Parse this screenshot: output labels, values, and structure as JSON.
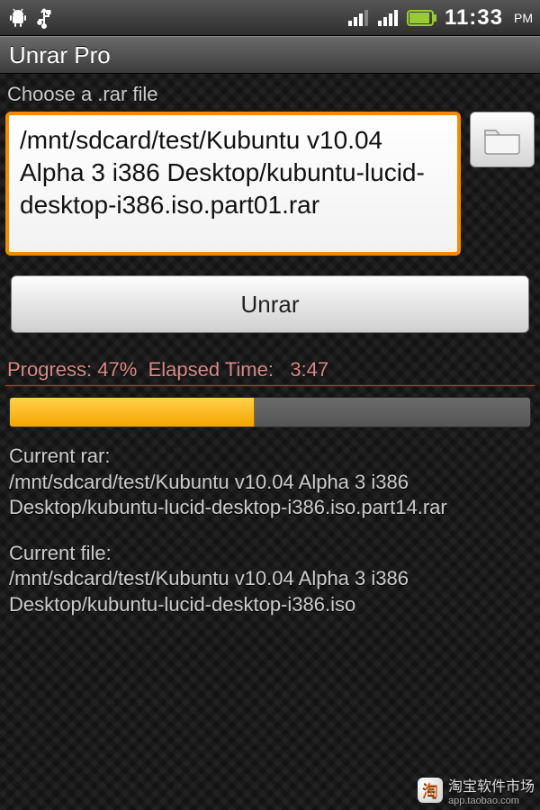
{
  "status": {
    "time": "11:33",
    "ampm": "PM"
  },
  "app": {
    "title": "Unrar Pro"
  },
  "choose_label": "Choose a .rar file",
  "file_path": "/mnt/sdcard/test/Kubuntu v10.04 Alpha 3 i386 Desktop/kubuntu-lucid-desktop-i386.iso.part01.rar",
  "unrar_label": "Unrar",
  "progress": {
    "label_prefix": "Progress:",
    "percent": 47,
    "percent_text": "47%",
    "elapsed_prefix": "Elapsed Time:",
    "elapsed": "3:47"
  },
  "current_rar": {
    "label": "Current rar:",
    "path": "/mnt/sdcard/test/Kubuntu v10.04 Alpha 3 i386 Desktop/kubuntu-lucid-desktop-i386.iso.part14.rar"
  },
  "current_file": {
    "label": "Current file:",
    "path": "/mnt/sdcard/test/Kubuntu v10.04 Alpha 3 i386 Desktop/kubuntu-lucid-desktop-i386.iso"
  },
  "watermark": {
    "text": "淘宝软件市场",
    "sub": "app.taobao.com"
  }
}
